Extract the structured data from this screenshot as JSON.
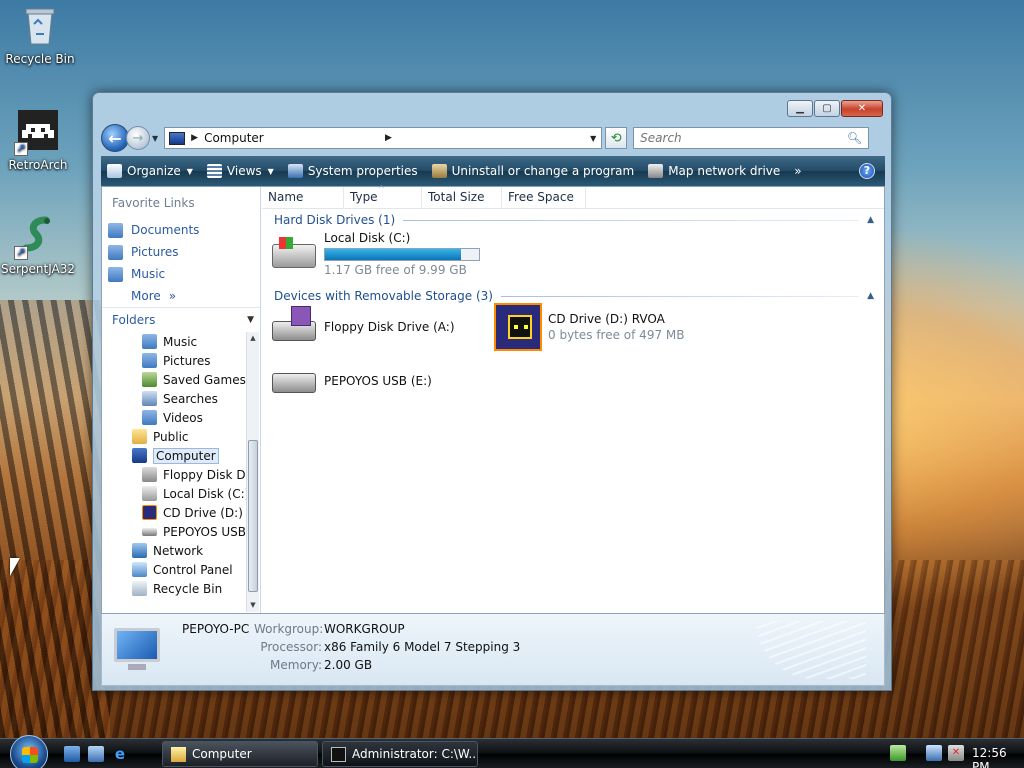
{
  "desktop": {
    "icons": [
      {
        "label": "Recycle Bin",
        "icon": "recycle-bin-icon"
      },
      {
        "label": "RetroArch",
        "icon": "retroarch-icon"
      },
      {
        "label": "SerpentJA32",
        "icon": "serpent-icon"
      }
    ]
  },
  "window": {
    "address_path": "Computer",
    "search_placeholder": "Search",
    "toolbar": {
      "organize": "Organize",
      "views": "Views",
      "system_properties": "System properties",
      "uninstall": "Uninstall or change a program",
      "map_drive": "Map network drive",
      "overflow": "»"
    },
    "nav": {
      "favorite_links_title": "Favorite Links",
      "favorites": [
        "Documents",
        "Pictures",
        "Music"
      ],
      "more": "More",
      "folders": "Folders",
      "tree": [
        {
          "label": "Music",
          "icon": "music-folder-icon"
        },
        {
          "label": "Pictures",
          "icon": "pictures-folder-icon"
        },
        {
          "label": "Saved Games",
          "icon": "saved-games-icon"
        },
        {
          "label": "Searches",
          "icon": "searches-icon"
        },
        {
          "label": "Videos",
          "icon": "videos-folder-icon"
        },
        {
          "label": "Public",
          "icon": "folder-icon"
        },
        {
          "label": "Computer",
          "icon": "computer-icon"
        },
        {
          "label": "Floppy Disk Dr",
          "icon": "floppy-icon"
        },
        {
          "label": "Local Disk (C:)",
          "icon": "hard-disk-icon"
        },
        {
          "label": "CD Drive (D:) R",
          "icon": "cd-drive-icon"
        },
        {
          "label": "PEPOYOS USB",
          "icon": "usb-drive-icon"
        },
        {
          "label": "Network",
          "icon": "network-icon"
        },
        {
          "label": "Control Panel",
          "icon": "control-panel-icon"
        },
        {
          "label": "Recycle Bin",
          "icon": "recycle-bin-icon"
        }
      ]
    },
    "columns": [
      "Name",
      "Type",
      "Total Size",
      "Free Space"
    ],
    "groups": {
      "hdd": "Hard Disk Drives (1)",
      "removable": "Devices with Removable Storage (3)"
    },
    "drives": {
      "c": {
        "name": "Local Disk (C:)",
        "free": "1.17 GB free of 9.99 GB",
        "used_fraction": 0.883
      },
      "a": {
        "name": "Floppy Disk Drive (A:)"
      },
      "d": {
        "name": "CD Drive (D:) RVOA",
        "free": "0 bytes free of 497 MB"
      },
      "e": {
        "name": "PEPOYOS USB (E:)"
      }
    },
    "details": {
      "pc_name": "PEPOYO-PC",
      "workgroup_label": "Workgroup:",
      "workgroup": "WORKGROUP",
      "processor_label": "Processor:",
      "processor": "x86 Family 6 Model 7 Stepping 3",
      "memory_label": "Memory:",
      "memory": "2.00 GB"
    }
  },
  "taskbar": {
    "buttons": [
      "Computer",
      "Administrator: C:\\W..."
    ],
    "clock": "12:56 PM"
  }
}
